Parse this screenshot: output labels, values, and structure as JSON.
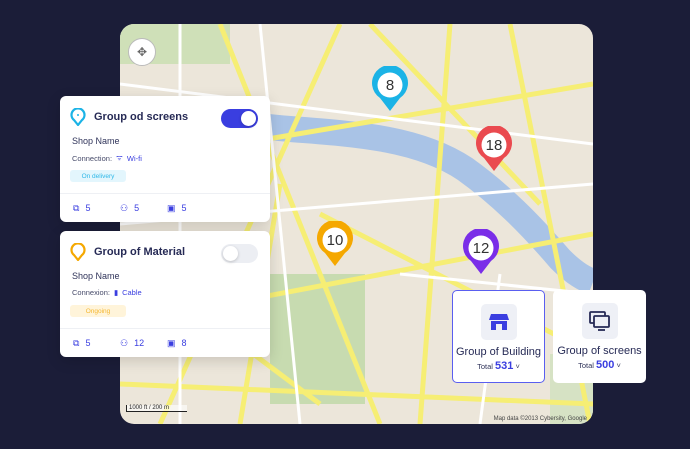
{
  "map": {
    "attribution": "Map data ©2013 Cybersity, Google",
    "scale": "1000 ft / 200 m"
  },
  "markers": [
    {
      "label": "8",
      "color": "#1bb3e6"
    },
    {
      "label": "18",
      "color": "#ea4a4f"
    },
    {
      "label": "10",
      "color": "#f5a800"
    },
    {
      "label": "12",
      "color": "#7a2ee8"
    }
  ],
  "cards": [
    {
      "title": "Group od screens",
      "icon": "pin-cyan",
      "toggle_on": true,
      "shop": "Shop Name",
      "connection_label": "Connection:",
      "connection_icon": "wifi-icon",
      "connection_value": "Wi-fi",
      "status": "On delivery",
      "status_bg": "#e3f6fd",
      "status_color": "#2eb8e8",
      "screens": "5",
      "users": "5",
      "media": "5"
    },
    {
      "title": "Group of Material",
      "icon": "pin-orange",
      "toggle_on": false,
      "shop": "Shop Name",
      "connection_label": "Connexion:",
      "connection_icon": "cable-icon",
      "connection_value": "Cable",
      "status": "Ongoing",
      "status_bg": "#fff4da",
      "status_color": "#f5b731",
      "screens": "5",
      "users": "12",
      "media": "8"
    }
  ],
  "groups": [
    {
      "name": "Group of Building",
      "total_label": "Total",
      "total": "531",
      "selected": true
    },
    {
      "name": "Group of screens",
      "total_label": "Total",
      "total": "500",
      "selected": false
    }
  ],
  "colors": {
    "accent": "#3a3ee0",
    "background": "#1b1d38"
  }
}
